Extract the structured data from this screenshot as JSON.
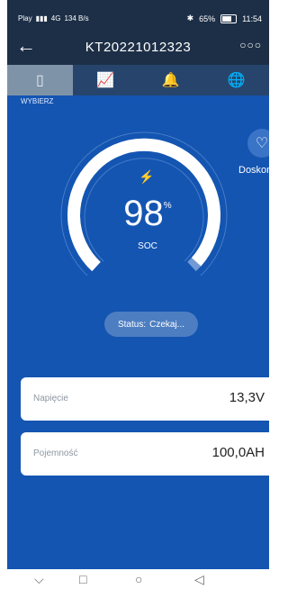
{
  "status_bar": {
    "carrier": "Play",
    "signal_info": "4G",
    "speed": "134 B/s",
    "battery_percent": "65%",
    "time": "11:54"
  },
  "header": {
    "title": "KT20221012323"
  },
  "tabs": [
    {
      "icon": "battery-icon",
      "active": true
    },
    {
      "icon": "chart-icon",
      "active": false
    },
    {
      "icon": "alarm-bell-icon",
      "active": false
    },
    {
      "icon": "globe-icon",
      "active": false
    }
  ],
  "select_label": "WYBIERZ",
  "diagnosis": {
    "label": "Doskona"
  },
  "soc": {
    "value": "98",
    "unit": "%",
    "label": "SOC",
    "fraction": 0.98
  },
  "status": {
    "label": "Status:",
    "value": "Czekaj..."
  },
  "cards": [
    {
      "label": "Napięcie",
      "value": "13,3V"
    },
    {
      "label": "Pojemność",
      "value": "100,0AH"
    }
  ],
  "colors": {
    "background": "#1455b2",
    "header": "#1d2f47",
    "tabbar": "#27456c",
    "gauge_fill": "#ffffff",
    "gauge_end": "#8ab0e0"
  }
}
